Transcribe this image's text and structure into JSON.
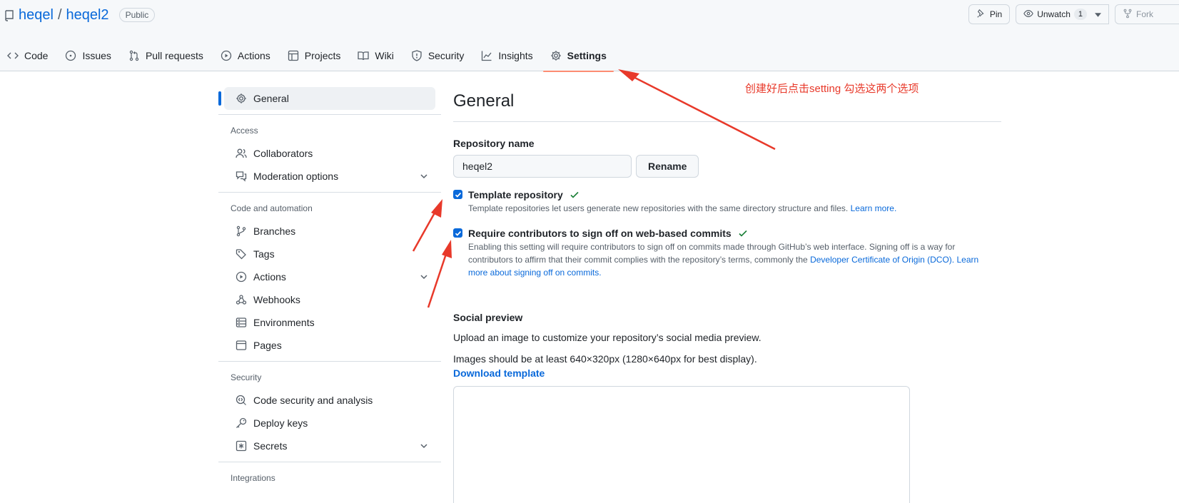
{
  "repo": {
    "owner": "heqel",
    "separator": "/",
    "name": "heqel2",
    "visibility": "Public"
  },
  "actions": {
    "pin_label": "Pin",
    "unwatch_label": "Unwatch",
    "watch_count": "1",
    "fork_label": "Fork"
  },
  "tabs": [
    {
      "label": "Code",
      "icon": "code-icon"
    },
    {
      "label": "Issues",
      "icon": "issue-icon"
    },
    {
      "label": "Pull requests",
      "icon": "pull-request-icon"
    },
    {
      "label": "Actions",
      "icon": "play-icon"
    },
    {
      "label": "Projects",
      "icon": "table-icon"
    },
    {
      "label": "Wiki",
      "icon": "book-icon"
    },
    {
      "label": "Security",
      "icon": "shield-icon"
    },
    {
      "label": "Insights",
      "icon": "graph-icon"
    },
    {
      "label": "Settings",
      "icon": "gear-icon",
      "active": true
    }
  ],
  "sidebar": {
    "general": "General",
    "access_heading": "Access",
    "collaborators": "Collaborators",
    "moderation": "Moderation options",
    "code_heading": "Code and automation",
    "branches": "Branches",
    "tags": "Tags",
    "actions": "Actions",
    "webhooks": "Webhooks",
    "environments": "Environments",
    "pages": "Pages",
    "security_heading": "Security",
    "code_security": "Code security and analysis",
    "deploy_keys": "Deploy keys",
    "secrets": "Secrets",
    "integrations_heading": "Integrations"
  },
  "main": {
    "title": "General",
    "repo_name_label": "Repository name",
    "repo_name_value": "heqel2",
    "rename_label": "Rename",
    "template": {
      "checked": true,
      "title": "Template repository",
      "note": "Template repositories let users generate new repositories with the same directory structure and files.",
      "link": "Learn more."
    },
    "signoff": {
      "checked": true,
      "title": "Require contributors to sign off on web-based commits",
      "note_1": "Enabling this setting will require contributors to sign off on commits made through GitHub’s web interface. Signing off is a way for contributors to affirm that their commit complies with the repository’s terms, commonly the",
      "link_dco": "Developer Certificate of Origin (DCO).",
      "link_more": "Learn more about signing off on commits."
    },
    "social": {
      "title": "Social preview",
      "para_1": "Upload an image to customize your repository’s social media preview.",
      "para_2": "Images should be at least 640×320px (1280×640px for best display).",
      "download": "Download template"
    }
  },
  "annotation": {
    "text": "创建好后点击setting 勾选这两个选项",
    "color": "#e8392a"
  }
}
